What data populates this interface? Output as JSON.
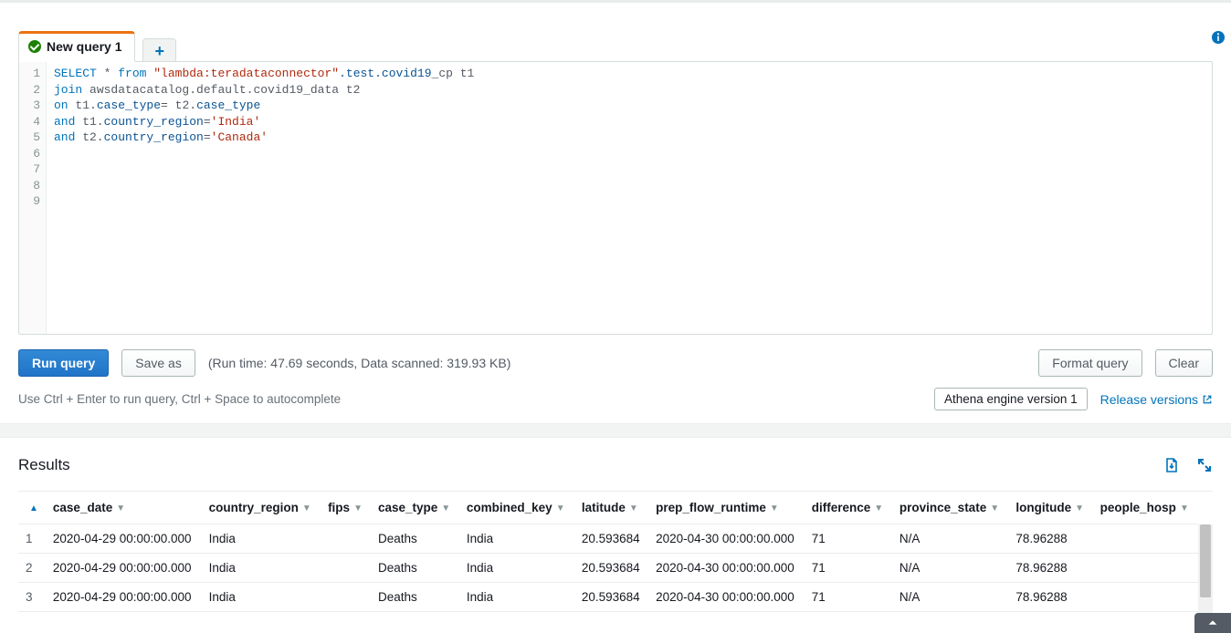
{
  "tab": {
    "label": "New query 1"
  },
  "editor": {
    "lines": [
      {
        "n": 1,
        "tokens": [
          {
            "t": "SELECT",
            "c": "kw"
          },
          {
            "t": " * "
          },
          {
            "t": "from",
            "c": "kw"
          },
          {
            "t": " "
          },
          {
            "t": "\"lambda:teradataconnector\"",
            "c": "str"
          },
          {
            "t": ".test.covid19",
            "c": "op"
          },
          {
            "t": "_cp t1"
          }
        ]
      },
      {
        "n": 2,
        "tokens": [
          {
            "t": "join",
            "c": "kw"
          },
          {
            "t": " awsdatacatalog.default.covid19"
          },
          {
            "t": "_data t2"
          }
        ]
      },
      {
        "n": 3,
        "tokens": [
          {
            "t": "on",
            "c": "kw"
          },
          {
            "t": " t1."
          },
          {
            "t": "case_type",
            "c": "op"
          },
          {
            "t": "= t2."
          },
          {
            "t": "case_type",
            "c": "op"
          }
        ]
      },
      {
        "n": 4,
        "tokens": [
          {
            "t": "and",
            "c": "kw"
          },
          {
            "t": " t1."
          },
          {
            "t": "country_region",
            "c": "op"
          },
          {
            "t": "="
          },
          {
            "t": "'India'",
            "c": "str"
          }
        ]
      },
      {
        "n": 5,
        "tokens": [
          {
            "t": "and",
            "c": "kw"
          },
          {
            "t": " t2."
          },
          {
            "t": "country_region",
            "c": "op"
          },
          {
            "t": "="
          },
          {
            "t": "'Canada'",
            "c": "str"
          }
        ]
      },
      {
        "n": 6,
        "tokens": []
      },
      {
        "n": 7,
        "tokens": []
      },
      {
        "n": 8,
        "tokens": []
      },
      {
        "n": 9,
        "tokens": []
      }
    ]
  },
  "toolbar": {
    "run_label": "Run query",
    "save_as_label": "Save as",
    "format_label": "Format query",
    "clear_label": "Clear",
    "stats": "(Run time: 47.69 seconds, Data scanned: 319.93 KB)"
  },
  "subbar": {
    "hint": "Use Ctrl + Enter to run query, Ctrl + Space to autocomplete",
    "engine_label": "Athena engine version 1",
    "release_link": "Release versions"
  },
  "results": {
    "heading": "Results",
    "columns": [
      {
        "key": "idx",
        "label": "",
        "sort": "asc"
      },
      {
        "key": "case_date",
        "label": "case_date"
      },
      {
        "key": "country_region",
        "label": "country_region"
      },
      {
        "key": "fips",
        "label": "fips"
      },
      {
        "key": "case_type",
        "label": "case_type"
      },
      {
        "key": "combined_key",
        "label": "combined_key"
      },
      {
        "key": "latitude",
        "label": "latitude"
      },
      {
        "key": "prep_flow_runtime",
        "label": "prep_flow_runtime"
      },
      {
        "key": "difference",
        "label": "difference"
      },
      {
        "key": "province_state",
        "label": "province_state"
      },
      {
        "key": "longitude",
        "label": "longitude"
      },
      {
        "key": "people_hosp",
        "label": "people_hosp"
      }
    ],
    "rows": [
      {
        "idx": 1,
        "case_date": "2020-04-29 00:00:00.000",
        "country_region": "India",
        "fips": "",
        "case_type": "Deaths",
        "combined_key": "India",
        "latitude": "20.593684",
        "prep_flow_runtime": "2020-04-30 00:00:00.000",
        "difference": "71",
        "province_state": "N/A",
        "longitude": "78.96288",
        "people_hosp": ""
      },
      {
        "idx": 2,
        "case_date": "2020-04-29 00:00:00.000",
        "country_region": "India",
        "fips": "",
        "case_type": "Deaths",
        "combined_key": "India",
        "latitude": "20.593684",
        "prep_flow_runtime": "2020-04-30 00:00:00.000",
        "difference": "71",
        "province_state": "N/A",
        "longitude": "78.96288",
        "people_hosp": ""
      },
      {
        "idx": 3,
        "case_date": "2020-04-29 00:00:00.000",
        "country_region": "India",
        "fips": "",
        "case_type": "Deaths",
        "combined_key": "India",
        "latitude": "20.593684",
        "prep_flow_runtime": "2020-04-30 00:00:00.000",
        "difference": "71",
        "province_state": "N/A",
        "longitude": "78.96288",
        "people_hosp": ""
      }
    ]
  }
}
